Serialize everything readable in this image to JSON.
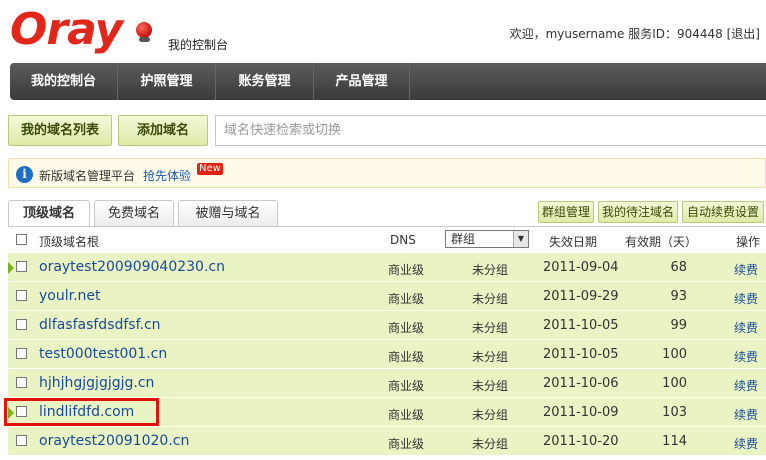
{
  "header": {
    "logo_text": "Oray",
    "console_label": "我的控制台",
    "welcome": "欢迎，myusername 服务ID：904448",
    "logout": "[退出]"
  },
  "mainnav": [
    {
      "label": "我的控制台"
    },
    {
      "label": "护照管理"
    },
    {
      "label": "账务管理"
    },
    {
      "label": "产品管理"
    }
  ],
  "toolbar": {
    "domain_list": "我的域名列表",
    "add_domain": "添加域名",
    "search_placeholder": "域名快速检索或切换"
  },
  "notice": {
    "text": "新版域名管理平台",
    "link": "抢先体验",
    "badge": "New"
  },
  "tabs": [
    {
      "label": "顶级域名",
      "active": true
    },
    {
      "label": "免费域名",
      "active": false
    },
    {
      "label": "被赠与域名",
      "active": false
    }
  ],
  "actions": {
    "group_manage": "群组管理",
    "pending_domains": "我的待注域名",
    "auto_renew": "自动续费设置"
  },
  "table": {
    "headers": {
      "name": "顶级域名根",
      "dns": "DNS",
      "group_select": "群组",
      "expire": "失效日期",
      "valid": "有效期（天）",
      "ops": "操作"
    },
    "rows": [
      {
        "name": "oraytest200909040230.cn",
        "dns": "商业级",
        "group": "未分组",
        "expire": "2011-09-04",
        "valid": "68",
        "op": "续费"
      },
      {
        "name": "youlr.net",
        "dns": "商业级",
        "group": "未分组",
        "expire": "2011-09-29",
        "valid": "93",
        "op": "续费"
      },
      {
        "name": "dlfasfasfdsdfsf.cn",
        "dns": "商业级",
        "group": "未分组",
        "expire": "2011-10-05",
        "valid": "99",
        "op": "续费"
      },
      {
        "name": "test000test001.cn",
        "dns": "商业级",
        "group": "未分组",
        "expire": "2011-10-05",
        "valid": "100",
        "op": "续费"
      },
      {
        "name": "hjhjhgjgjgjgjg.cn",
        "dns": "商业级",
        "group": "未分组",
        "expire": "2011-10-06",
        "valid": "100",
        "op": "续费"
      },
      {
        "name": "lindlifdfd.com",
        "dns": "商业级",
        "group": "未分组",
        "expire": "2011-10-09",
        "valid": "103",
        "op": "续费"
      },
      {
        "name": "oraytest20091020.cn",
        "dns": "商业级",
        "group": "未分组",
        "expire": "2011-10-20",
        "valid": "114",
        "op": "续费"
      }
    ]
  }
}
